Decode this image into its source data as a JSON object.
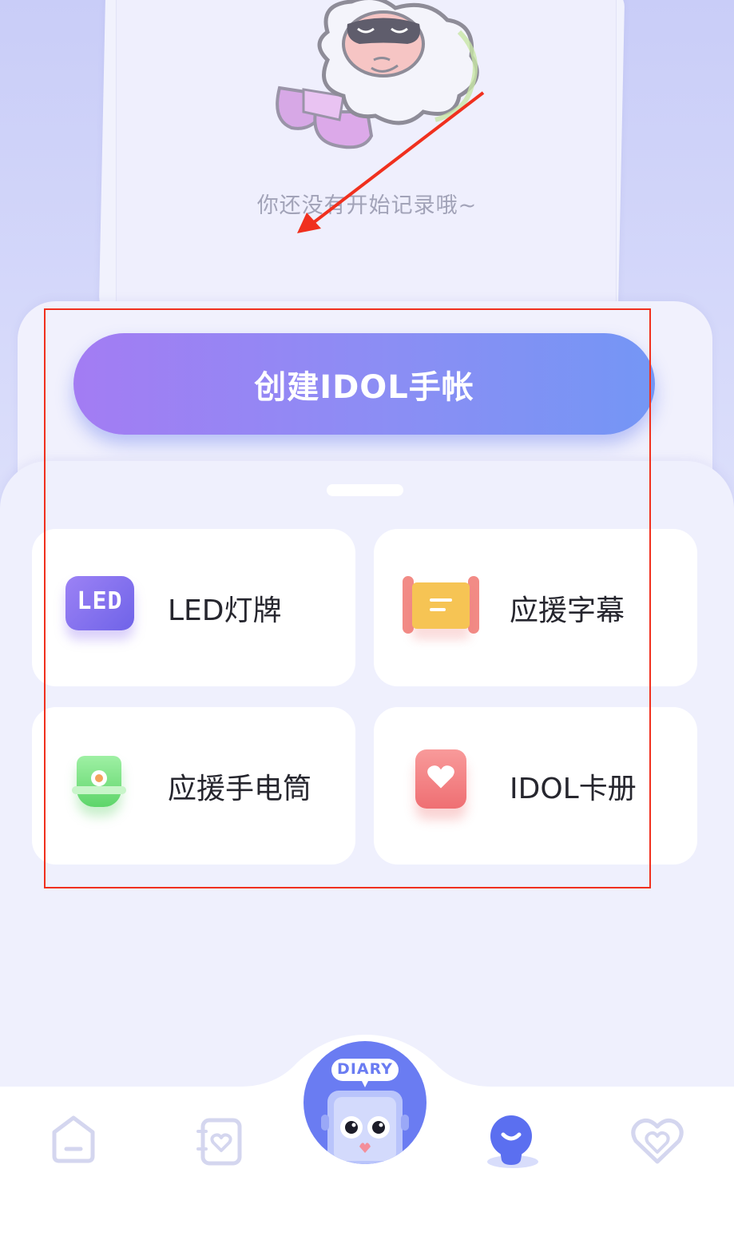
{
  "empty_state": {
    "text": "你还没有开始记录哦~"
  },
  "create": {
    "label": "创建IDOL手帐"
  },
  "tools": [
    {
      "label": "LED灯牌",
      "icon": "led-sign-icon"
    },
    {
      "label": "应援字幕",
      "icon": "scroll-banner-icon"
    },
    {
      "label": "应援手电筒",
      "icon": "flashlight-icon"
    },
    {
      "label": "IDOL卡册",
      "icon": "heart-card-album-icon"
    }
  ],
  "led_icon_text": "LED",
  "diary_badge": "DIARY",
  "nav": {
    "items": [
      {
        "icon": "home-icon",
        "active": false
      },
      {
        "icon": "heart-notebook-icon",
        "active": false
      },
      {
        "icon": "diary-mascot-icon",
        "active": false
      },
      {
        "icon": "lightbulb-icon",
        "active": true
      },
      {
        "icon": "heart-icon",
        "active": false
      }
    ]
  },
  "colors": {
    "accent_start": "#a37cf3",
    "accent_end": "#7496f5",
    "nav_active": "#5b6ff0",
    "nav_inactive": "#d4d6ef",
    "annotation": "#f0301e"
  }
}
